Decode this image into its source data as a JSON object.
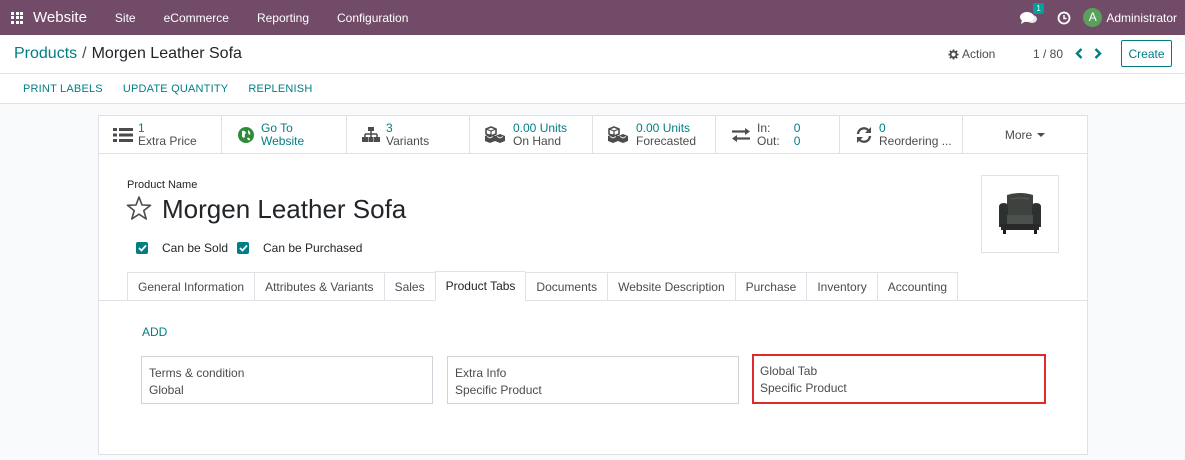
{
  "navbar": {
    "brand": "Website",
    "menus": [
      "Site",
      "eCommerce",
      "Reporting",
      "Configuration"
    ],
    "chat_badge": "1",
    "avatar_letter": "A",
    "username": "Administrator"
  },
  "control_panel": {
    "breadcrumb_parent": "Products",
    "breadcrumb_sep": "/",
    "breadcrumb_current": "Morgen Leather Sofa",
    "action_label": "Action",
    "pager": "1 / 80",
    "create_label": "Create"
  },
  "statusbar": {
    "buttons": [
      "PRINT LABELS",
      "UPDATE QUANTITY",
      "REPLENISH"
    ]
  },
  "smart_buttons": [
    {
      "value": "1",
      "label": "Extra Price",
      "icon": "list-icon"
    },
    {
      "value": "Go To",
      "label": "Website",
      "icon": "globe-icon"
    },
    {
      "value": "3",
      "label": "Variants",
      "icon": "sitemap-icon"
    },
    {
      "value": "0.00 Units",
      "label": "On Hand",
      "icon": "cubes-icon"
    },
    {
      "value": "0.00 Units",
      "label": "Forecasted",
      "icon": "cubes-icon"
    },
    {
      "in_label": "In:",
      "in_value": "0",
      "out_label": "Out:",
      "out_value": "0",
      "icon": "exchange-icon"
    },
    {
      "value": "0",
      "label": "Reordering ...",
      "icon": "refresh-icon"
    },
    {
      "label": "More"
    }
  ],
  "form": {
    "product_name_label": "Product Name",
    "product_name": "Morgen Leather Sofa",
    "can_be_sold": "Can be Sold",
    "can_be_purchased": "Can be Purchased"
  },
  "tabs": [
    "General Information",
    "Attributes & Variants",
    "Sales",
    "Product Tabs",
    "Documents",
    "Website Description",
    "Purchase",
    "Inventory",
    "Accounting"
  ],
  "active_tab": "Product Tabs",
  "product_tabs": {
    "add_label": "ADD",
    "cards": [
      {
        "title": "Terms & condition",
        "subtitle": "Global"
      },
      {
        "title": "Extra Info",
        "subtitle": "Specific Product"
      },
      {
        "title": "Global Tab",
        "subtitle": "Specific Product"
      }
    ]
  },
  "colors": {
    "navbar": "#714b67",
    "accent": "#017e84",
    "highlight": "#e02a2a"
  }
}
